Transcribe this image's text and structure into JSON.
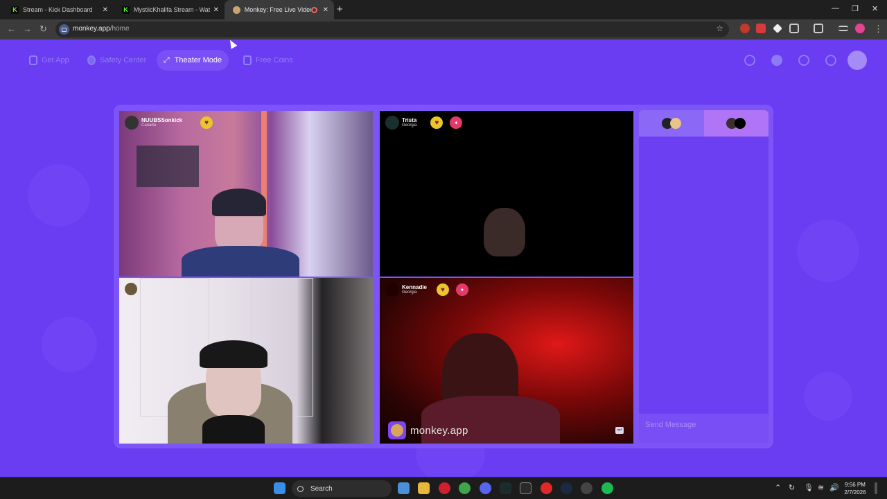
{
  "browser": {
    "tabs": [
      {
        "title": "Stream - Kick Dashboard",
        "favicon": "kick-icon"
      },
      {
        "title": "MystiicKhalifa Stream - Watch Live",
        "favicon": "kick-icon"
      },
      {
        "title": "Monkey: Free Live Video Chat",
        "favicon": "monkey-icon",
        "active": true
      }
    ],
    "url_host": "monkey.app",
    "url_path": "/home"
  },
  "monkey": {
    "nav": {
      "get_app": "Get App",
      "safety_center": "Safety Center",
      "theater_mode": "Theater Mode",
      "free_coins": "Free Coins"
    },
    "tiles": [
      {
        "name": "NUUBSSonkick",
        "location": "Canada"
      },
      {
        "name": "Trista",
        "location": "Georgia"
      },
      {
        "name": "",
        "location": ""
      },
      {
        "name": "Kennadie",
        "location": "Georgia"
      }
    ],
    "watermark": "monkey.app",
    "chat_placeholder": "Send Message"
  },
  "taskbar": {
    "search": "Search",
    "time": "9:56 PM",
    "date": "2/7/2026"
  },
  "colors": {
    "page_bg": "#6a3cf2",
    "accent": "#7a50f6",
    "heart": "#e8c62c"
  }
}
